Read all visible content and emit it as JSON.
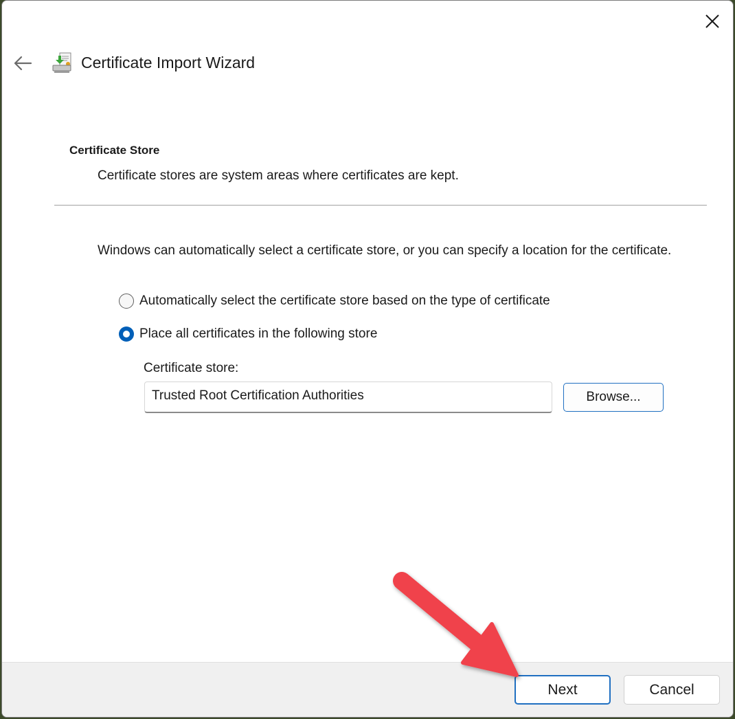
{
  "wizard": {
    "title": "Certificate Import Wizard",
    "back_icon": "arrow-left-icon",
    "close_icon": "close-icon",
    "app_icon": "certificate-wizard-icon"
  },
  "page": {
    "heading": "Certificate Store",
    "description": "Certificate stores are system areas where certificates are kept.",
    "intro": "Windows can automatically select a certificate store, or you can specify a location for the certificate."
  },
  "options": {
    "auto_label": "Automatically select the certificate store based on the type of certificate",
    "auto_selected": false,
    "place_label": "Place all certificates in the following store",
    "place_selected": true
  },
  "store": {
    "label": "Certificate store:",
    "value": "Trusted Root Certification Authorities",
    "browse_label": "Browse..."
  },
  "footer": {
    "next_label": "Next",
    "cancel_label": "Cancel"
  },
  "colors": {
    "accent": "#005fb8",
    "annotation_arrow": "#f0434b"
  }
}
